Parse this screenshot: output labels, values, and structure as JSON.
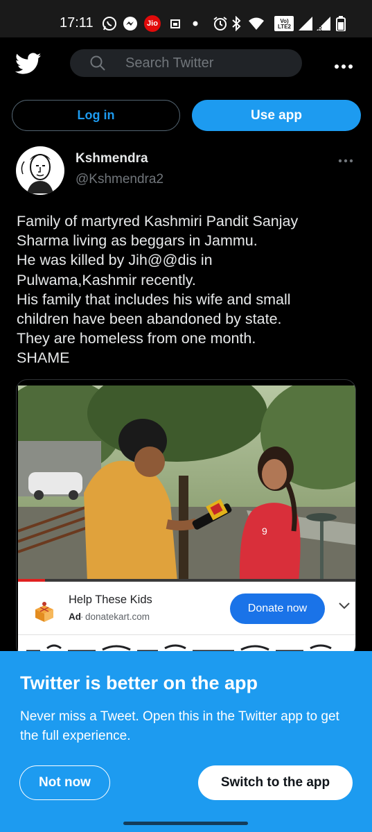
{
  "status_bar": {
    "time": "17:11",
    "jio_label": "Jio",
    "lte_label": "Vo) LTE2",
    "icons": [
      "whatsapp-icon",
      "messenger-icon",
      "jio-icon",
      "calendar-icon",
      "dot-icon",
      "alarm-icon",
      "bluetooth-icon",
      "wifi-icon",
      "lte-icon",
      "signal-icon",
      "signal-r-icon",
      "battery-icon"
    ]
  },
  "header": {
    "logo": "twitter-bird-icon",
    "search_placeholder": "Search Twitter",
    "more_icon": "more-horizontal-icon"
  },
  "auth": {
    "login_label": "Log in",
    "use_app_label": "Use app"
  },
  "tweet": {
    "author_name": "Kshmendra",
    "author_handle": "@Kshmendra2",
    "text": "Family of martyred Kashmiri Pandit Sanjay\nSharma living as beggars in Jammu.\nHe was killed by Jih@@dis in\nPulwama,Kashmir recently.\nHis family that includes his wife and small\nchildren have been abandoned by state.\nThey are homeless from one month.\nSHAME",
    "video_progress": 0.08
  },
  "ad": {
    "title": "Help These Kids",
    "label": "Ad",
    "separator": "·",
    "domain": "donatekart.com",
    "cta": "Donate now"
  },
  "app_sheet": {
    "title": "Twitter is better on the app",
    "body": "Never miss a Tweet. Open this in the Twitter app to get the full experience.",
    "not_now_label": "Not now",
    "switch_label": "Switch to the app"
  },
  "colors": {
    "twitter_blue": "#1d9bf0",
    "background": "#000000",
    "donate_blue": "#1a73e8"
  }
}
